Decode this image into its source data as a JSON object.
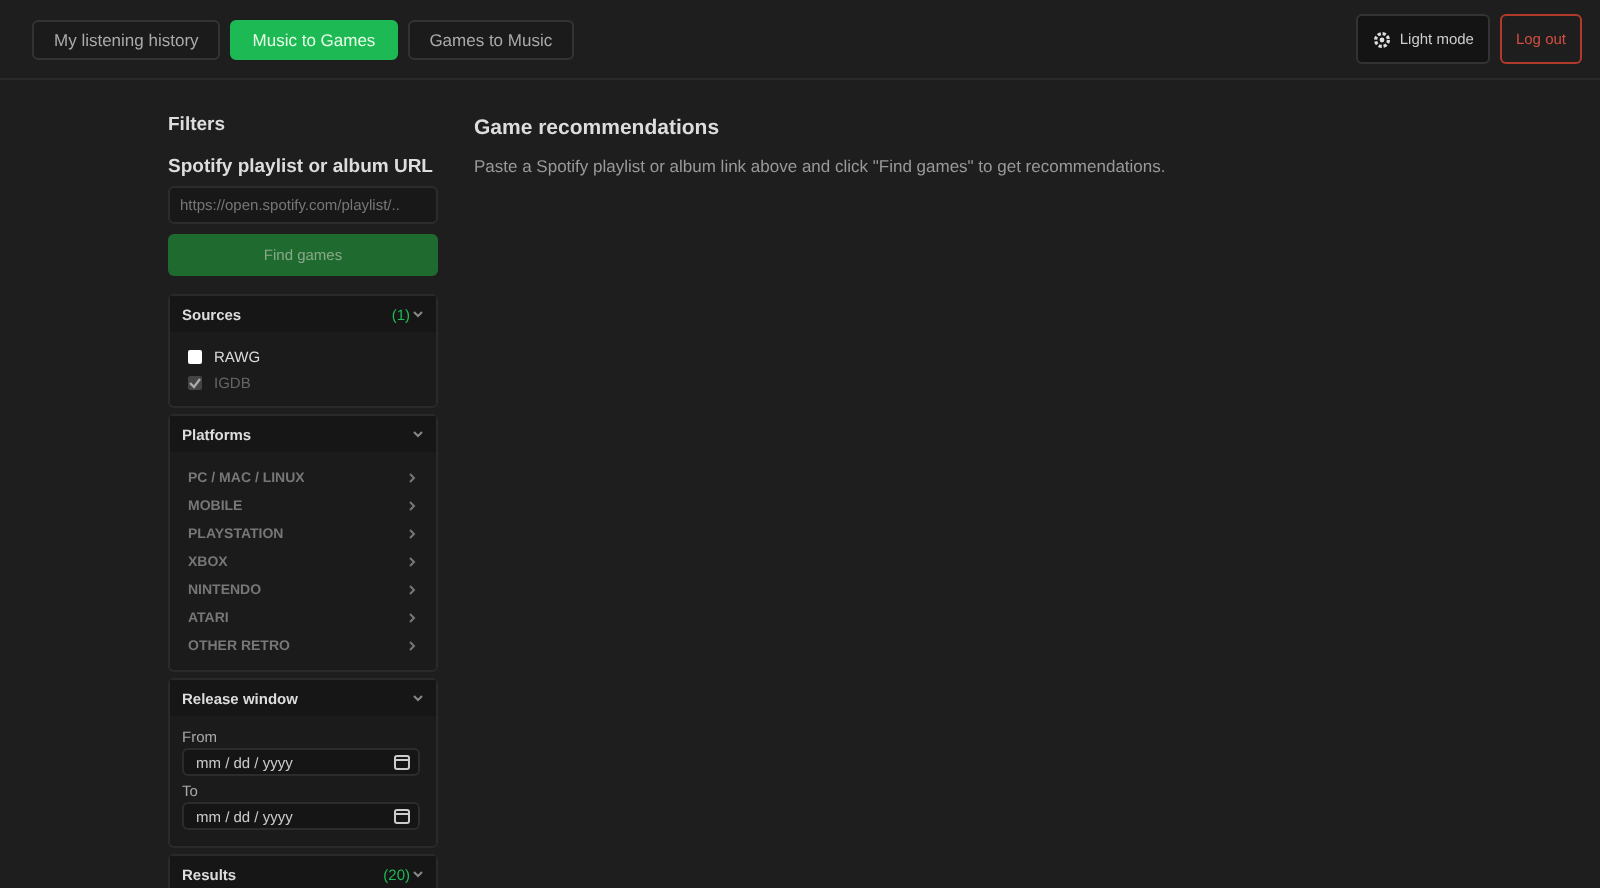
{
  "nav_tabs": [
    {
      "label": "My listening history",
      "selected": false
    },
    {
      "label": "Music to Games",
      "selected": true
    },
    {
      "label": "Games to Music",
      "selected": false
    }
  ],
  "header_buttons": [
    {
      "kind": "theme",
      "label": "Light mode"
    },
    {
      "kind": "logout",
      "label": "Log out"
    }
  ],
  "sidebar": {
    "title": "Filters",
    "url_label": "Spotify playlist or album URL",
    "url_field": {
      "placeholder": "https://open.spotify.com/playlist/.."
    },
    "find_button": {
      "label": "Find games",
      "disabled": true
    },
    "sections": [
      {
        "kind": "sources",
        "title": "Sources",
        "count": "(1)",
        "items": [
          {
            "label": "RAWG",
            "checked": false,
            "disabled": false
          },
          {
            "label": "IGDB",
            "checked": true,
            "disabled": true
          }
        ]
      },
      {
        "kind": "platforms",
        "title": "Platforms",
        "items": [
          {
            "label": "PC / MAC / LINUX"
          },
          {
            "label": "MOBILE"
          },
          {
            "label": "PLAYSTATION"
          },
          {
            "label": "XBOX"
          },
          {
            "label": "NINTENDO"
          },
          {
            "label": "ATARI"
          },
          {
            "label": "OTHER RETRO"
          }
        ]
      },
      {
        "kind": "dates",
        "title": "Release window",
        "fields": [
          {
            "label": "From",
            "placeholder": "mm / dd / yyyy"
          },
          {
            "label": "To",
            "placeholder": "mm / dd / yyyy"
          }
        ]
      },
      {
        "kind": "results",
        "title": "Results",
        "count": "(20)"
      }
    ]
  },
  "main": {
    "title": "Game recommendations",
    "message": "Paste a Spotify playlist or album link above and click \"Find games\" to get recommendations."
  }
}
